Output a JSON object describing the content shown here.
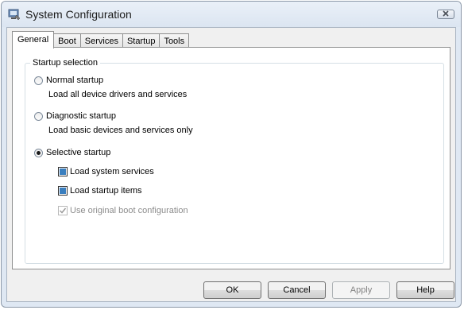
{
  "window": {
    "title": "System Configuration",
    "icon": "system-config-icon"
  },
  "tabs": [
    {
      "label": "General"
    },
    {
      "label": "Boot"
    },
    {
      "label": "Services"
    },
    {
      "label": "Startup"
    },
    {
      "label": "Tools"
    }
  ],
  "startup_selection": {
    "legend": "Startup selection",
    "normal": {
      "label": "Normal startup",
      "description": "Load all device drivers and services",
      "selected": false
    },
    "diagnostic": {
      "label": "Diagnostic startup",
      "description": "Load basic devices and services only",
      "selected": false
    },
    "selective": {
      "label": "Selective startup",
      "selected": true,
      "load_system_services": {
        "label": "Load system services",
        "state": "indeterminate"
      },
      "load_startup_items": {
        "label": "Load startup items",
        "state": "indeterminate"
      },
      "use_original_boot": {
        "label": "Use original boot configuration",
        "checked": true,
        "disabled": true
      }
    }
  },
  "buttons": {
    "ok": "OK",
    "cancel": "Cancel",
    "apply": "Apply",
    "help": "Help"
  }
}
